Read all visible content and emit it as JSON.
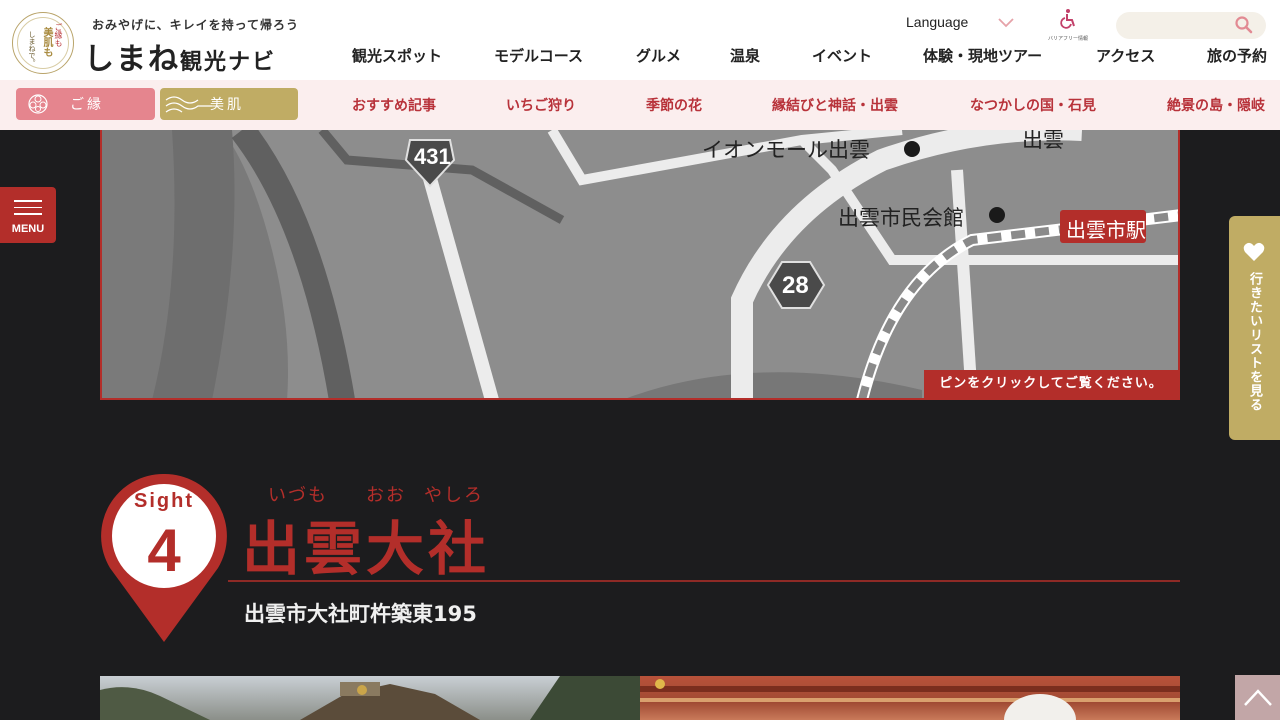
{
  "header": {
    "catchphrase": "おみやげに、キレイを持って帰ろう",
    "site_title": "しまね",
    "site_title_suffix": "観光ナビ",
    "seal_text_1": "ご縁も",
    "seal_text_2": "美肌も",
    "seal_text_3": "しまねで。",
    "language_label": "Language",
    "barrier_free_label": "バリアフリー情報",
    "search_placeholder": "",
    "nav": [
      {
        "label": "観光スポット"
      },
      {
        "label": "モデルコース"
      },
      {
        "label": "グルメ"
      },
      {
        "label": "温泉"
      },
      {
        "label": "イベント"
      },
      {
        "label": "体験・現地ツアー"
      },
      {
        "label": "アクセス"
      },
      {
        "label": "旅の予約"
      }
    ]
  },
  "subnav": {
    "tag_goen": "ご縁",
    "tag_bihada": "美肌",
    "items": [
      {
        "label": "おすすめ記事"
      },
      {
        "label": "いちご狩り"
      },
      {
        "label": "季節の花"
      },
      {
        "label": "縁結びと神話・出雲"
      },
      {
        "label": "なつかしの国・石見"
      },
      {
        "label": "絶景の島・隠岐"
      }
    ]
  },
  "map": {
    "labels": {
      "aeon": "イオンモール出雲",
      "civic_hall": "出雲市民会館",
      "izumo_top": "出雲",
      "station": "出雲市駅",
      "route_431": "431",
      "route_28": "28"
    },
    "hint": "ピンをクリックしてご覧ください。"
  },
  "side": {
    "menu_label": "MENU",
    "wishlist_label": "行きたいリストを見る"
  },
  "sight": {
    "word": "Sight",
    "number": "4",
    "ruby": [
      "いづも",
      "おお",
      "やしろ"
    ],
    "title": "出雲大社",
    "address": "出雲市大社町杵築東195"
  },
  "colors": {
    "brand_red": "#b32e2a",
    "gold": "#c0ac64",
    "pink": "#e5858e",
    "subnav_bg": "#fbeeee",
    "page_bg": "#1c1c1e"
  }
}
